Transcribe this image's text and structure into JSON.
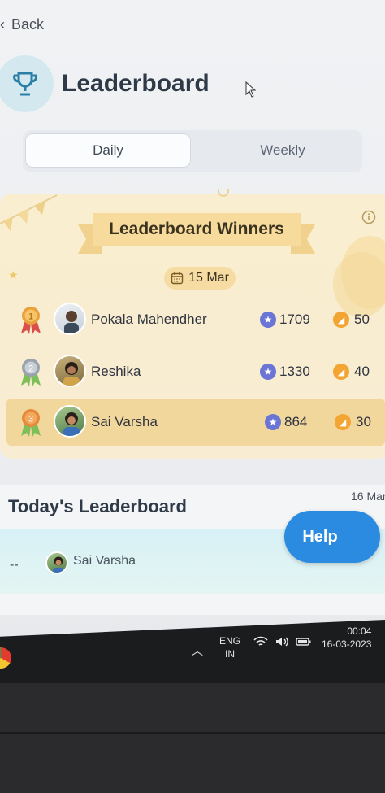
{
  "nav": {
    "back_label": "Back"
  },
  "header": {
    "title": "Leaderboard"
  },
  "tabs": [
    {
      "label": "Daily",
      "active": true
    },
    {
      "label": "Weekly",
      "active": false
    }
  ],
  "winners": {
    "title": "Leaderboard Winners",
    "date": "15 Mar",
    "entries": [
      {
        "rank": "1",
        "name": "Pokala Mahendher",
        "points": "1709",
        "coins": "50",
        "medal_color": "#e9a23b"
      },
      {
        "rank": "2",
        "name": "Reshika",
        "points": "1330",
        "coins": "40",
        "medal_color": "#9aa3ad"
      },
      {
        "rank": "3",
        "name": "Sai Varsha",
        "points": "864",
        "coins": "30",
        "medal_color": "#e58a3a"
      }
    ]
  },
  "today": {
    "title": "Today's Leaderboard",
    "date": "16 Mar",
    "entry": {
      "rank": "--",
      "name": "Sai Varsha"
    }
  },
  "help": {
    "label": "Help"
  },
  "taskbar": {
    "lang_line1": "ENG",
    "lang_line2": "IN",
    "time": "00:04",
    "date": "16-03-2023"
  },
  "colors": {
    "accent": "#2a8be0",
    "card_bg": "#faeed0",
    "highlight_row": "#f2d79c",
    "star_badge": "#6a75d6",
    "coin_badge": "#f3a534"
  }
}
